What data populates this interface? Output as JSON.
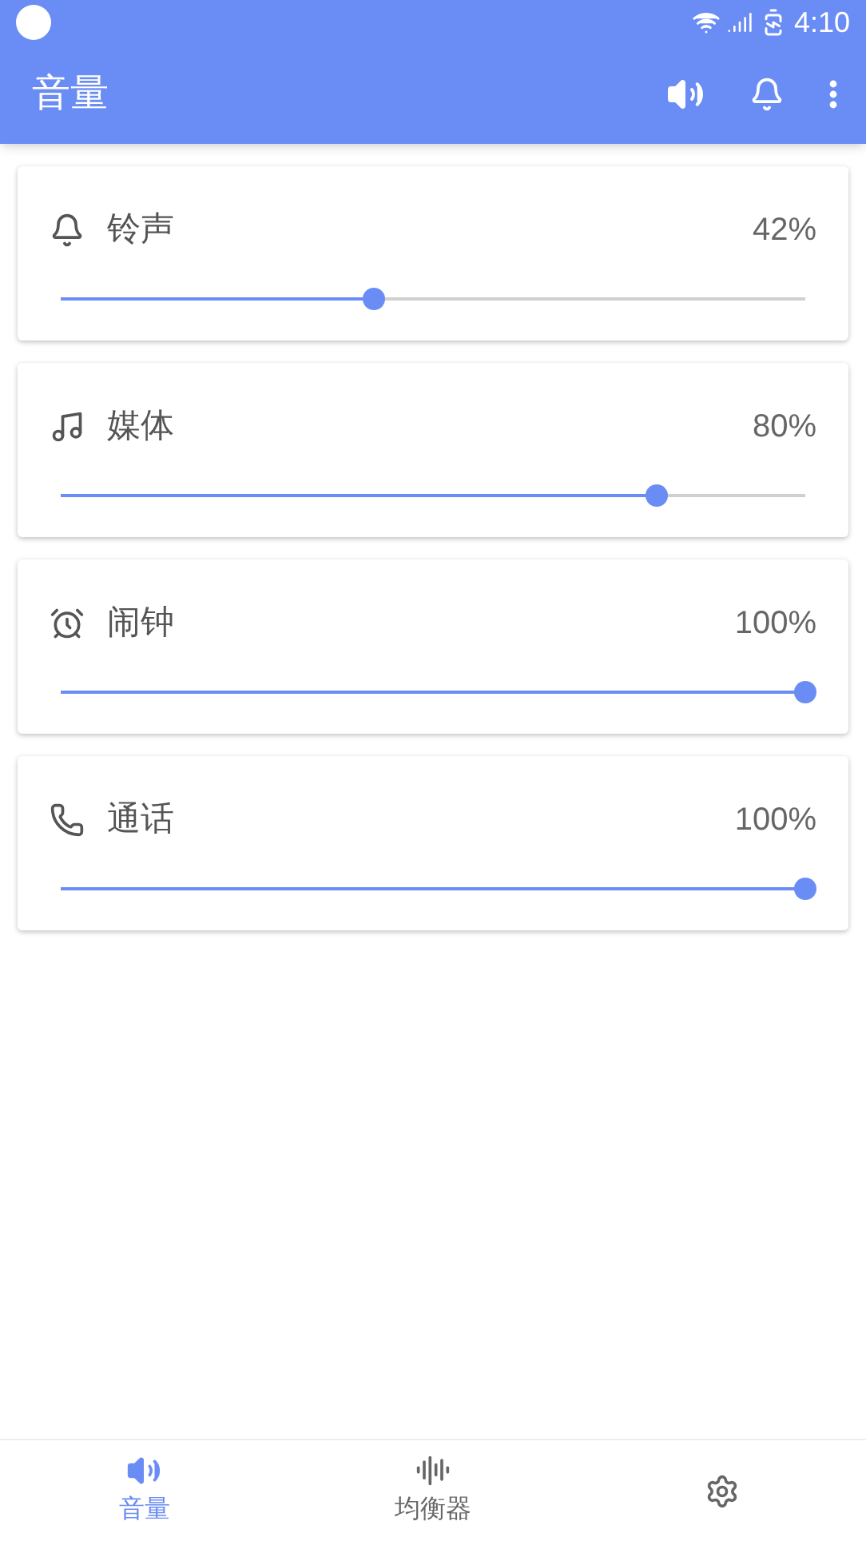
{
  "status_bar": {
    "time": "4:10"
  },
  "app_bar": {
    "title": "音量"
  },
  "volumes": [
    {
      "kind": "bell",
      "label": "铃声",
      "reading": "42%",
      "level": 0.42
    },
    {
      "kind": "note",
      "label": "媒体",
      "reading": "80%",
      "level": 0.8
    },
    {
      "kind": "alarm",
      "label": "闹钟",
      "reading": "100%",
      "level": 1
    },
    {
      "kind": "phone",
      "label": "通话",
      "reading": "100%",
      "level": 1
    }
  ],
  "bottom_nav": [
    {
      "kind": "speaker",
      "label": "音量",
      "selected": true
    },
    {
      "kind": "equalizer",
      "label": "均衡器",
      "selected": false
    },
    {
      "kind": "gear",
      "selected": false
    }
  ]
}
